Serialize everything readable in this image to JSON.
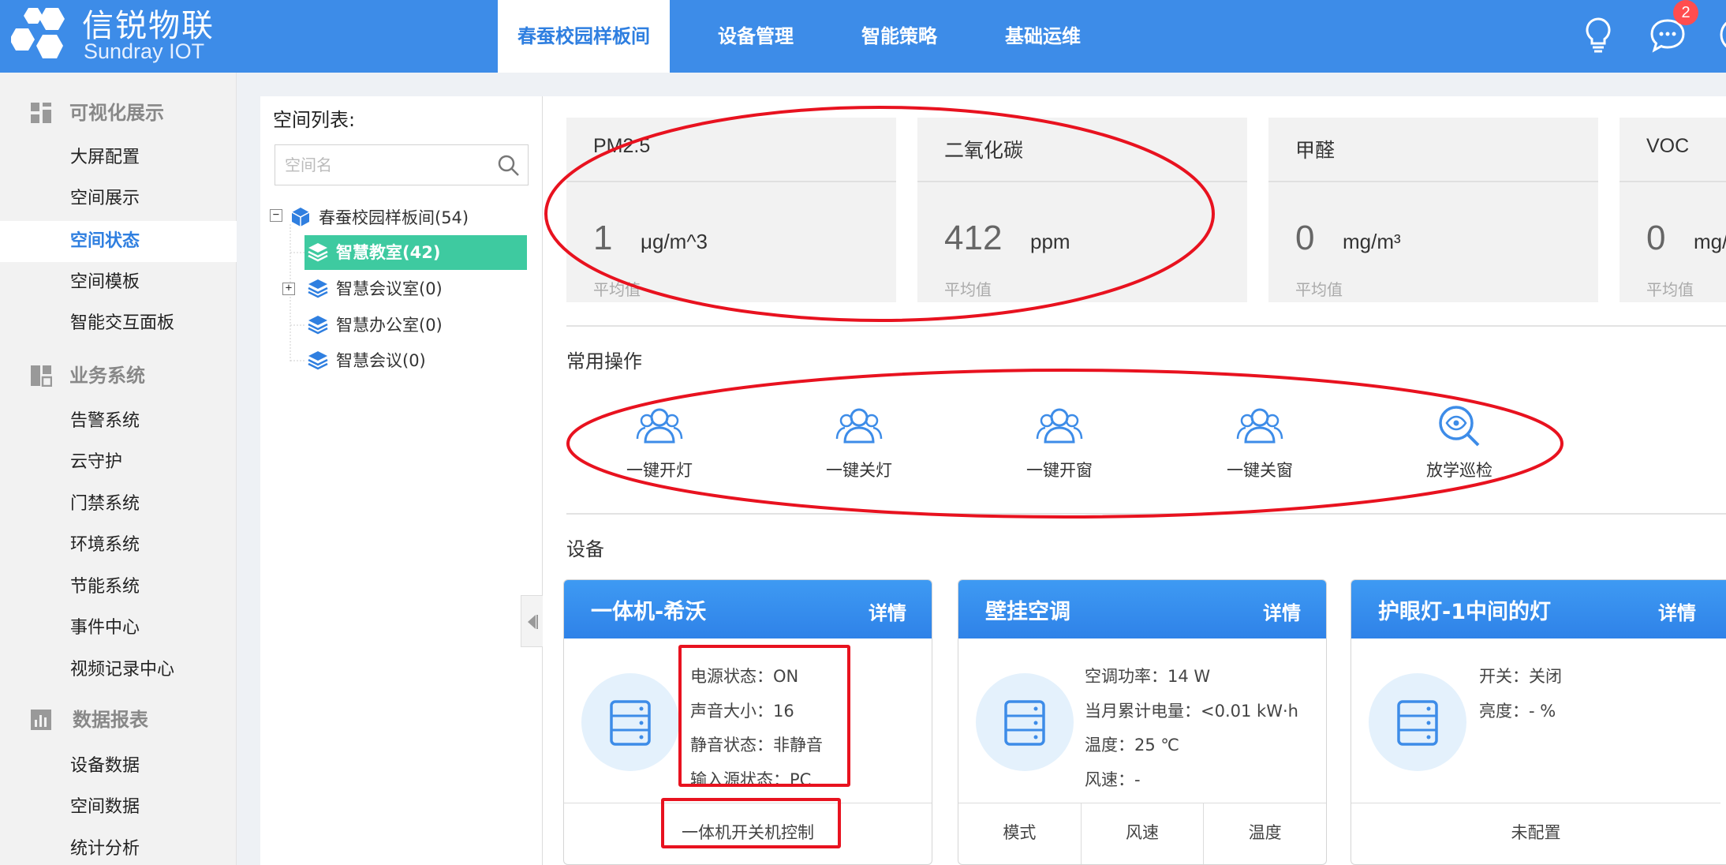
{
  "brand": {
    "name_cn": "信锐物联",
    "name_en": "Sundray IOT"
  },
  "nav": [
    {
      "label": "春蚕校园样板间",
      "active": true
    },
    {
      "label": "设备管理",
      "active": false
    },
    {
      "label": "智能策略",
      "active": false
    },
    {
      "label": "基础运维",
      "active": false
    }
  ],
  "header": {
    "message_badge": "2"
  },
  "sidebar": {
    "groups": [
      {
        "label": "可视化展示",
        "icon": "dashboard-icon",
        "items": [
          "大屏配置",
          "空间展示",
          "空间状态",
          "空间模板",
          "智能交互面板"
        ]
      },
      {
        "label": "业务系统",
        "icon": "apps-icon",
        "items": [
          "告警系统",
          "云守护",
          "门禁系统",
          "环境系统",
          "节能系统",
          "事件中心",
          "视频记录中心"
        ]
      },
      {
        "label": "数据报表",
        "icon": "bar-chart-icon",
        "items": [
          "设备数据",
          "空间数据",
          "统计分析"
        ]
      }
    ],
    "active_item": "空间状态"
  },
  "tree": {
    "title": "空间列表:",
    "search_placeholder": "空间名",
    "root": {
      "label": "春蚕校园样板间(54)",
      "expander": "−"
    },
    "children": [
      {
        "label": "智慧教室(42)",
        "selected": true,
        "expander": ""
      },
      {
        "label": "智慧会议室(0)",
        "selected": false,
        "expander": "+"
      },
      {
        "label": "智慧办公室(0)",
        "selected": false,
        "expander": ""
      },
      {
        "label": "智慧会议(0)",
        "selected": false,
        "expander": ""
      }
    ]
  },
  "metrics": [
    {
      "name": "PM2.5",
      "value": "1",
      "unit": "μg/m^3",
      "sub": "平均值"
    },
    {
      "name": "二氧化碳",
      "value": "412",
      "unit": "ppm",
      "sub": "平均值"
    },
    {
      "name": "甲醛",
      "value": "0",
      "unit": "mg/m³",
      "sub": "平均值"
    },
    {
      "name": "VOC",
      "value": "0",
      "unit": "mg/",
      "sub": "平均值"
    }
  ],
  "operations": {
    "title": "常用操作",
    "items": [
      {
        "label": "一键开灯",
        "icon": "users-icon"
      },
      {
        "label": "一键关灯",
        "icon": "users-icon"
      },
      {
        "label": "一键开窗",
        "icon": "users-icon"
      },
      {
        "label": "一键关窗",
        "icon": "users-icon"
      },
      {
        "label": "放学巡检",
        "icon": "eye-search-icon"
      }
    ]
  },
  "devices": {
    "title": "设备",
    "cards": [
      {
        "name": "一体机-希沃",
        "detail": "详情",
        "props": [
          "电源状态：ON",
          "声音大小：16",
          "静音状态：非静音",
          "输入源状态：PC"
        ],
        "footer": [
          "一体机开关机控制"
        ]
      },
      {
        "name": "壁挂空调",
        "detail": "详情",
        "props": [
          "空调功率：14 W",
          "当月累计电量：<0.01 kW·h",
          "温度：25 ℃",
          "风速：-"
        ],
        "footer": [
          "模式",
          "风速",
          "温度"
        ]
      },
      {
        "name": "护眼灯-1中间的灯",
        "detail": "详情",
        "props": [
          "开关：关闭",
          "亮度：- %"
        ],
        "footer": [
          "未配置"
        ]
      }
    ]
  },
  "colors": {
    "header_bg": "#3d8ce8",
    "accent": "#2f7fe0",
    "tree_selected": "#3ecaa0",
    "annotation_red": "#e8121f"
  }
}
